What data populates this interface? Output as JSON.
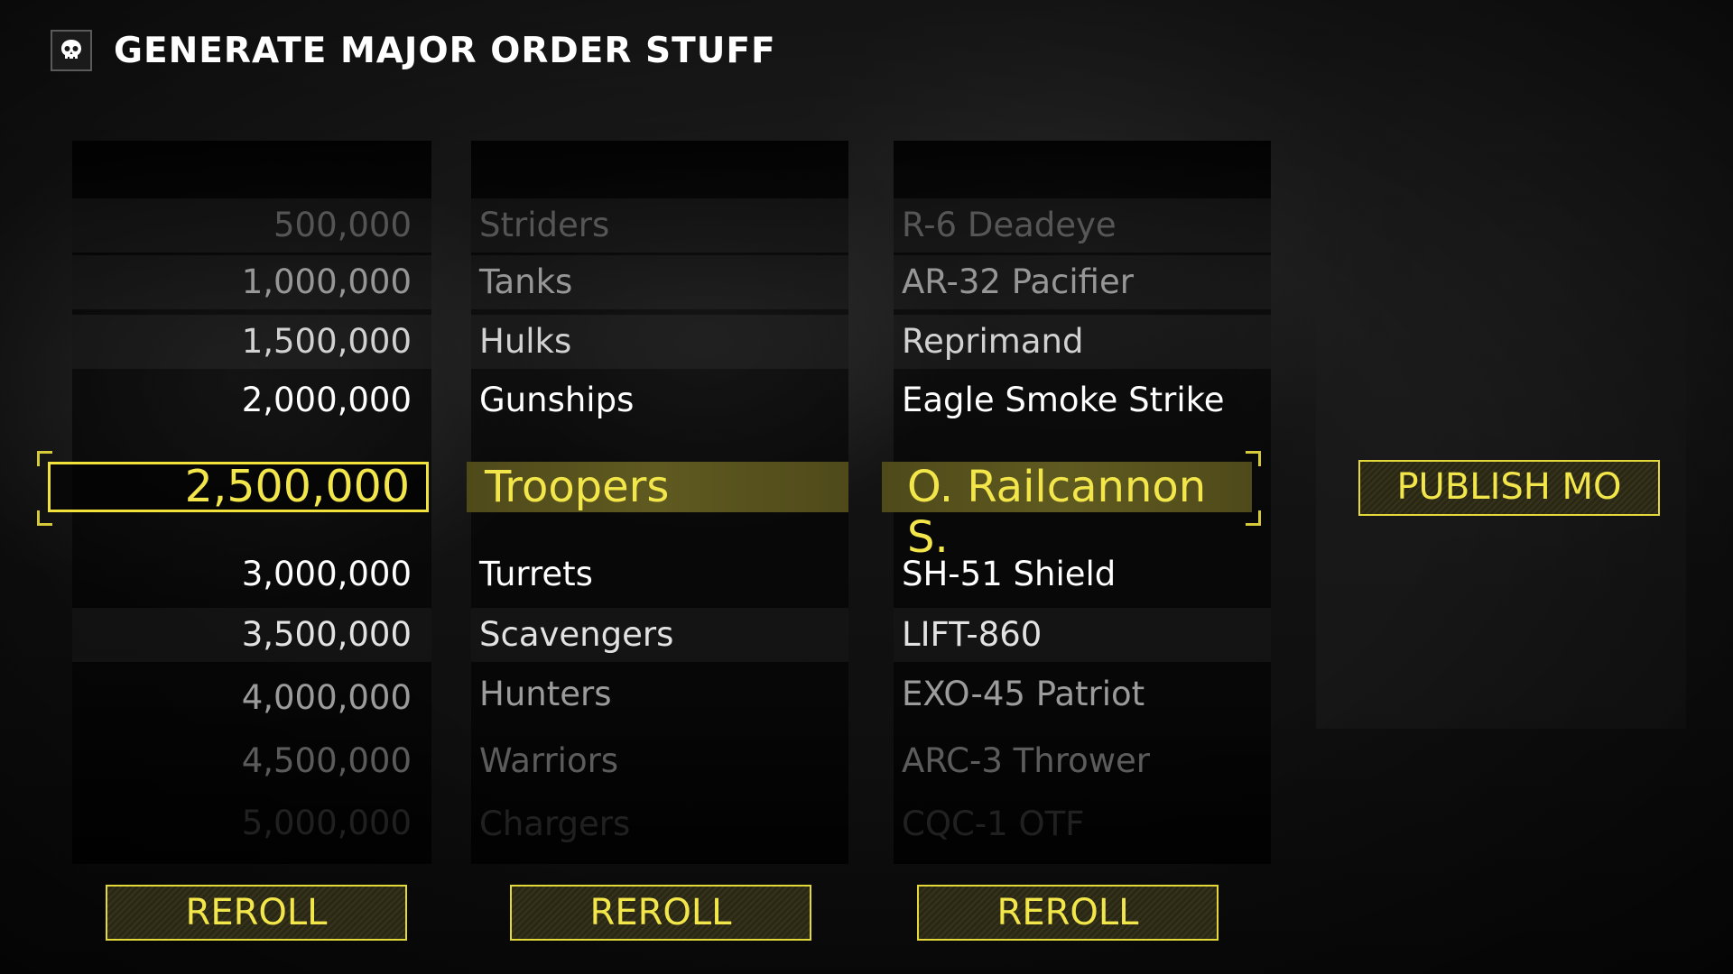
{
  "header": {
    "title": "GENERATE MAJOR ORDER STUFF",
    "logo_icon": "skull-icon"
  },
  "numbers": {
    "above": [
      "500,000",
      "1,000,000",
      "1,500,000",
      "2,000,000"
    ],
    "selected": "2,500,000",
    "below": [
      "3,000,000",
      "3,500,000",
      "4,000,000",
      "4,500,000",
      "5,000,000"
    ]
  },
  "enemies": {
    "above": [
      "Striders",
      "Tanks",
      "Hulks",
      "Gunships"
    ],
    "selected": "Troopers",
    "below": [
      "Turrets",
      "Scavengers",
      "Hunters",
      "Warriors",
      "Chargers"
    ]
  },
  "stratagems": {
    "above": [
      "R-6 Deadeye",
      "AR-32 Pacifier",
      "Reprimand",
      "Eagle Smoke Strike"
    ],
    "selected": "O. Railcannon S.",
    "below": [
      "SH-51 Shield",
      "LIFT-860",
      "EXO-45 Patriot",
      "ARC-3 Thrower",
      "CQC-1 OTF"
    ]
  },
  "buttons": {
    "publish": "PUBLISH MO",
    "reroll": [
      "REROLL",
      "REROLL",
      "REROLL"
    ]
  },
  "colors": {
    "accent": "#f2e64a",
    "selected_bg": "#5a5520",
    "text": "#ffffff"
  }
}
